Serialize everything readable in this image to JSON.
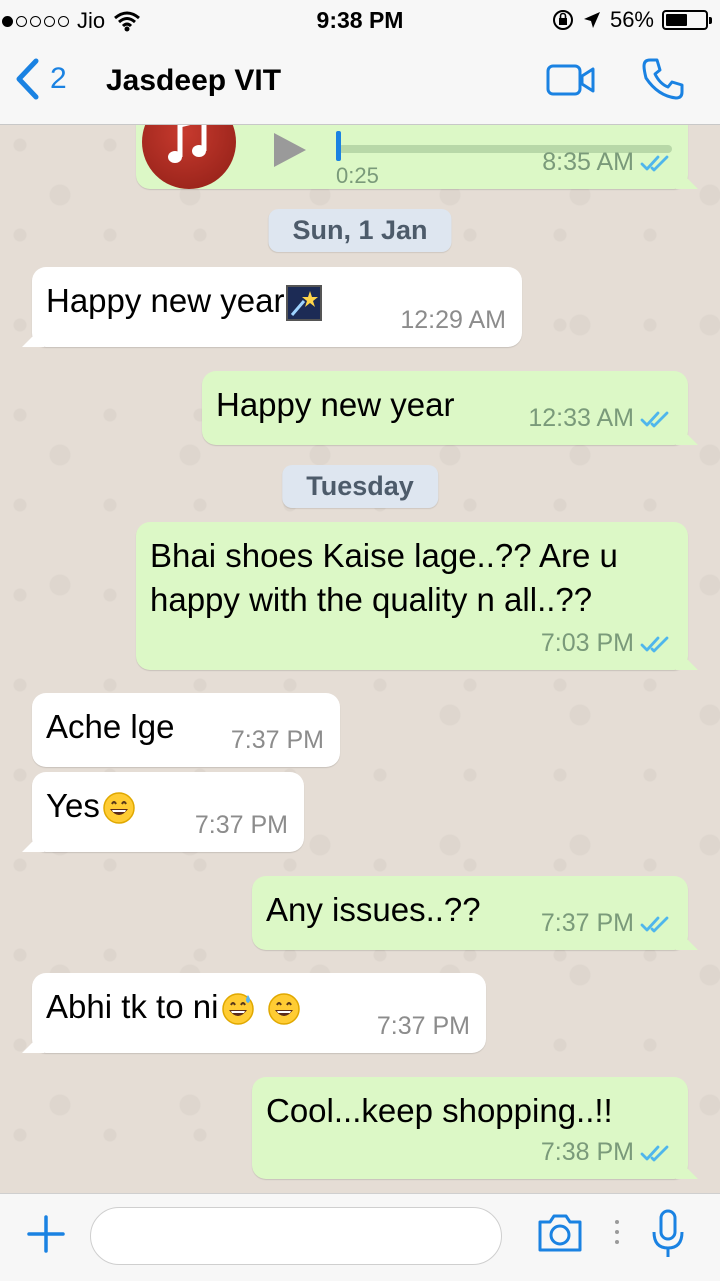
{
  "status_bar": {
    "carrier": "Jio",
    "signal_bars": 1,
    "time": "9:38 PM",
    "battery_percent": "56%",
    "battery_level": 0.56
  },
  "nav": {
    "back_count": "2",
    "contact_name": "Jasdeep VIT"
  },
  "audio_message": {
    "duration": "0:25",
    "time": "8:35 AM"
  },
  "date_separators": [
    "Sun, 1 Jan",
    "Tuesday"
  ],
  "messages": [
    {
      "dir": "in",
      "text": "Happy new year",
      "emoji": "shooting-star-emoji",
      "time": "12:29 AM"
    },
    {
      "dir": "out",
      "text": "Happy new year",
      "time": "12:33 AM"
    },
    {
      "dir": "out",
      "text": "Bhai shoes Kaise lage..?? Are u happy with the quality n all..??",
      "time": "7:03 PM"
    },
    {
      "dir": "in",
      "text": "Ache lge",
      "time": "7:37 PM"
    },
    {
      "dir": "in",
      "text": "Yes",
      "emoji": "grinning-emoji",
      "time": "7:37 PM"
    },
    {
      "dir": "out",
      "text": "Any issues..??",
      "time": "7:37 PM"
    },
    {
      "dir": "in",
      "text": "Abhi tk to ni",
      "emoji": "sweat-smile-emoji grinning-emoji",
      "time": "7:37 PM"
    },
    {
      "dir": "out",
      "text": "Cool...keep shopping..!!",
      "time": "7:38 PM"
    }
  ],
  "input": {
    "placeholder": "",
    "value": ""
  },
  "colors": {
    "accent": "#1a82e2",
    "outgoing_bubble": "#dcf8c6",
    "incoming_bubble": "#ffffff",
    "chat_background": "#e5ddd5",
    "read_ticks": "#4fb6ec"
  },
  "icons": [
    "back-chevron-icon",
    "video-call-icon",
    "phone-call-icon",
    "music-note-icon",
    "play-icon",
    "double-tick-icon",
    "plus-icon",
    "camera-icon",
    "mic-icon"
  ]
}
